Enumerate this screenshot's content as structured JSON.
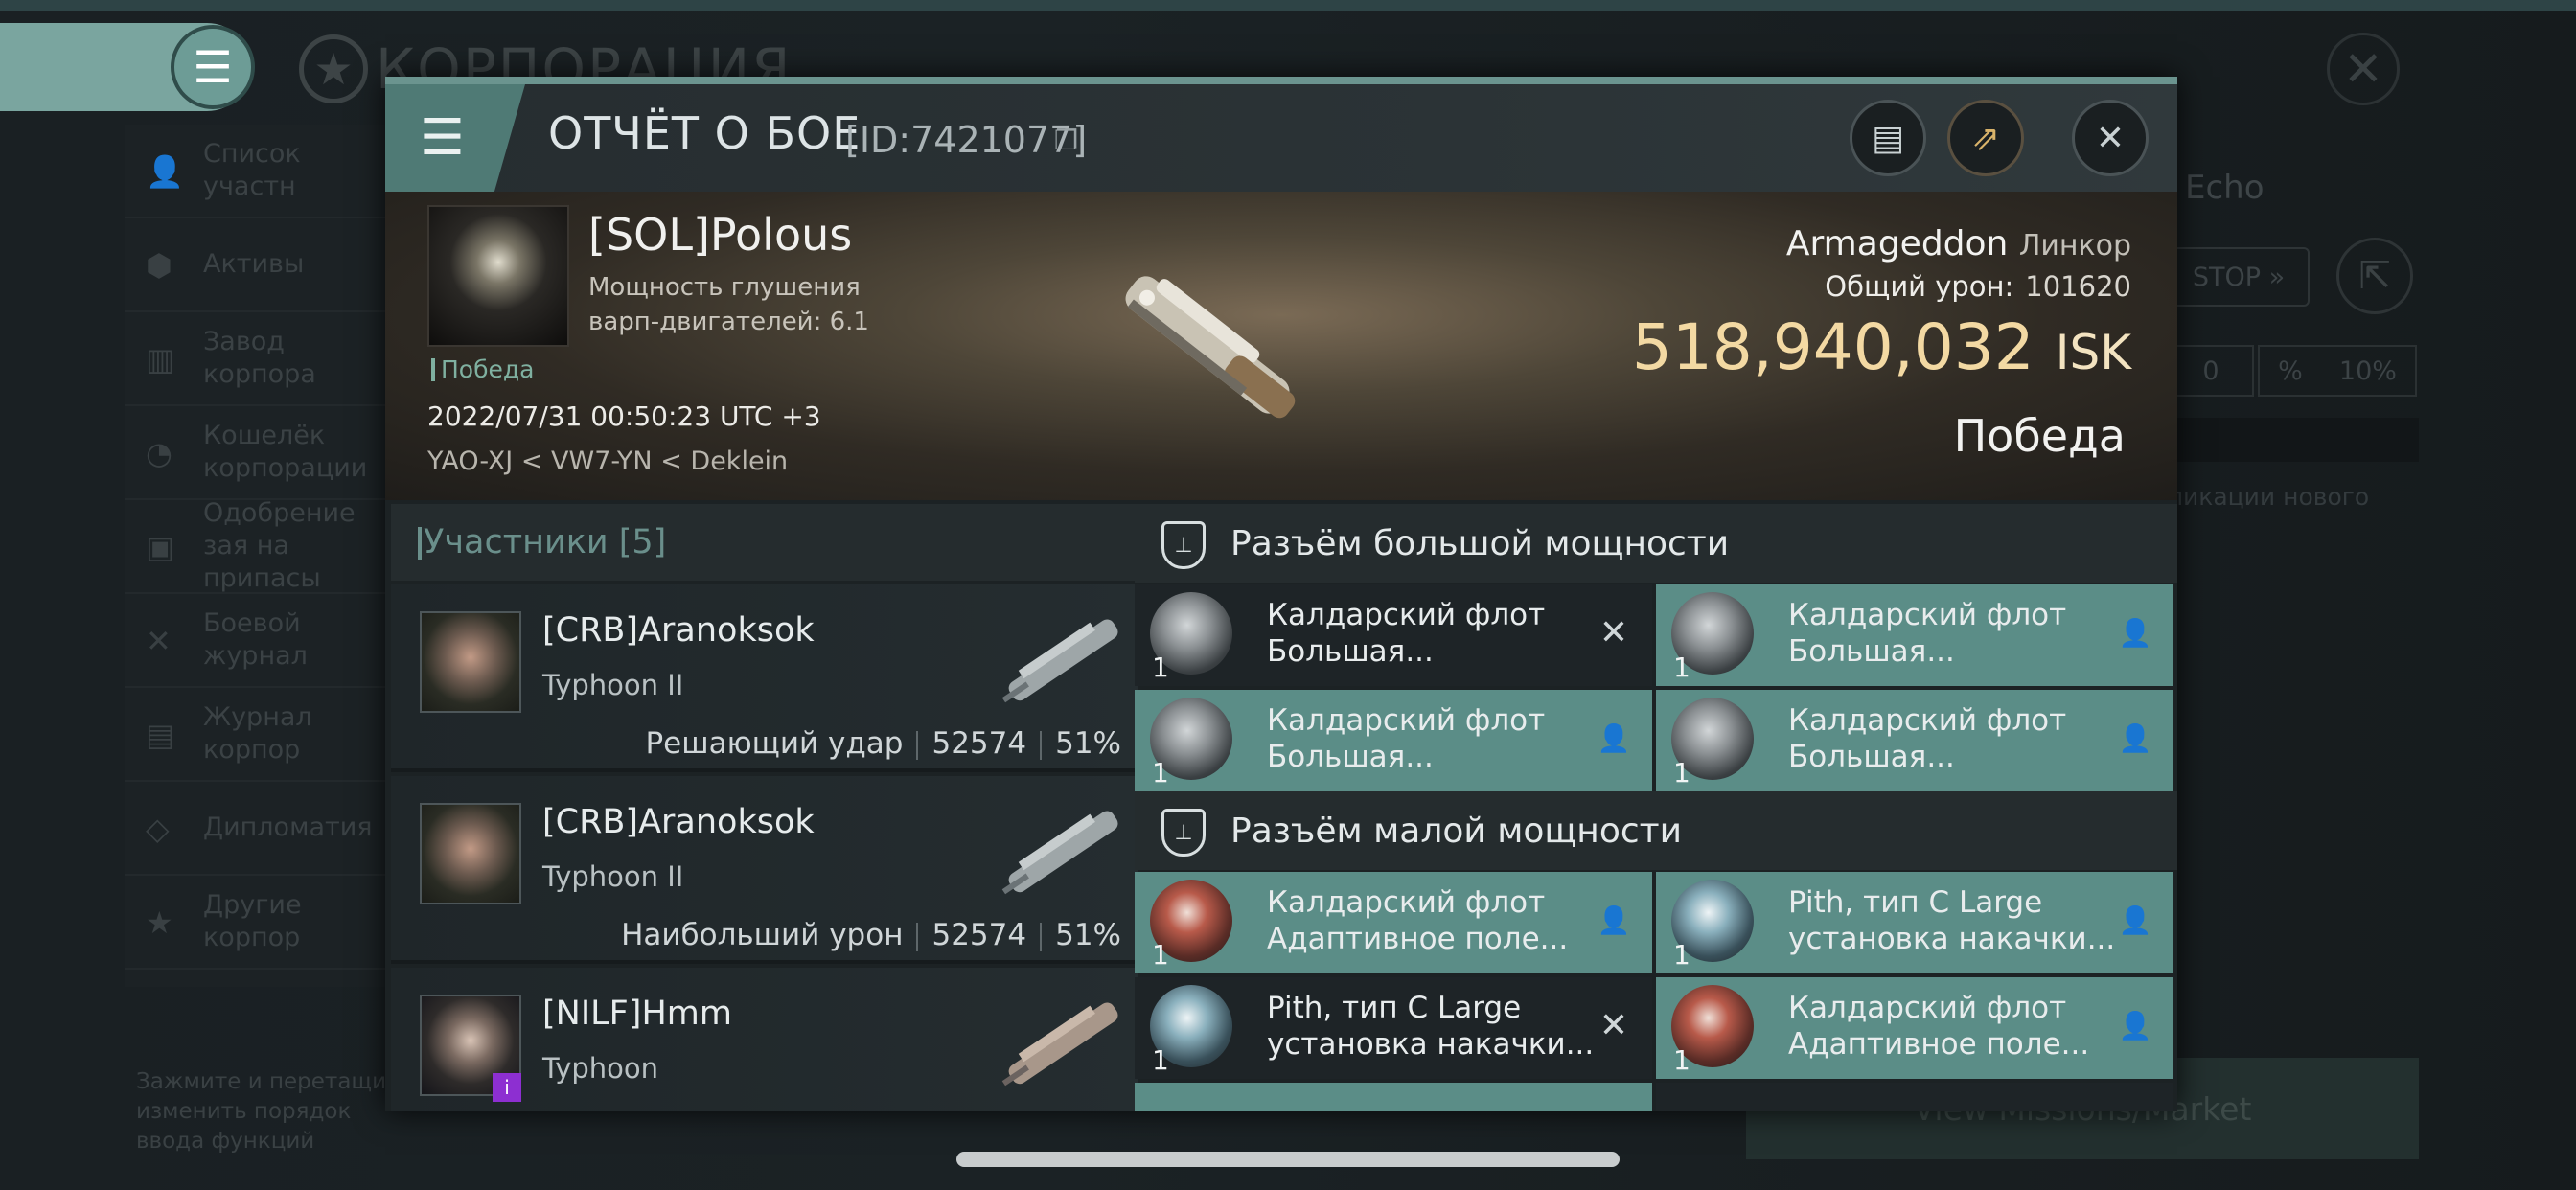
{
  "background": {
    "title": "КОРПОРАЦИЯ",
    "nav": [
      {
        "label": "Список участн",
        "icon": "members-icon"
      },
      {
        "label": "Активы",
        "icon": "assets-icon"
      },
      {
        "label": "Завод корпора",
        "icon": "factory-icon"
      },
      {
        "label": "Кошелёк корпорации",
        "icon": "wallet-icon"
      },
      {
        "label": "Одобрение зая на припасы",
        "icon": "approval-icon"
      },
      {
        "label": "Боевой журнал",
        "icon": "combat-log-icon"
      },
      {
        "label": "Журнал корпор",
        "icon": "journal-icon"
      },
      {
        "label": "Дипломатия",
        "icon": "diplomacy-icon"
      },
      {
        "label": "Другие корпор",
        "icon": "corporations-icon"
      }
    ],
    "hint": "Зажмите и перетащите изменить порядок ввода функций",
    "echo": "Echo",
    "stop": "STOP",
    "field1": "0",
    "field2": "10%",
    "subtext": "ликации нового",
    "bottom_button": "View Missions/Market"
  },
  "dialog": {
    "title": "ОТЧЁТ О БОЕ",
    "report_id": "[ID:7421077]",
    "victim": {
      "name": "[SOL]Polous",
      "stat_line": "Мощность глушения варп-двигателей: 6.1",
      "result_tag": "Победа",
      "datetime": "2022/07/31 00:50:23 UTC +3",
      "location": "YAO-XJ < VW7-YN < Deklein"
    },
    "ship": {
      "name": "Armageddon",
      "class": "Линкор"
    },
    "total_damage_label": "Общий урон:",
    "total_damage": "101620",
    "isk_value": "518,940,032",
    "isk_unit": "ISK",
    "outcome": "Победа",
    "participants_header": "Участники [5]",
    "participants": [
      {
        "name": "[CRB]Aranoksok",
        "ship": "Typhoon II",
        "role": "Решающий удар",
        "damage": "52574",
        "percent": "51%"
      },
      {
        "name": "[CRB]Aranoksok",
        "ship": "Typhoon II",
        "role": "Наибольший урон",
        "damage": "52574",
        "percent": "51%"
      },
      {
        "name": "[NILF]Hmm",
        "ship": "Typhoon",
        "role": "",
        "damage": "",
        "percent": "",
        "badge": "i"
      }
    ],
    "high_slots_title": "Разъём большой мощности",
    "high_slots": [
      {
        "line1": "Калдарский флот",
        "line2": "Большая...",
        "qty": "1",
        "state": "destroyed"
      },
      {
        "line1": "Калдарский флот",
        "line2": "Большая...",
        "qty": "1",
        "state": "dropped"
      },
      {
        "line1": "Калдарский флот",
        "line2": "Большая...",
        "qty": "1",
        "state": "dropped"
      },
      {
        "line1": "Калдарский флот",
        "line2": "Большая...",
        "qty": "1",
        "state": "dropped"
      }
    ],
    "low_slots_title": "Разъём малой мощности",
    "low_slots": [
      {
        "line1": "Калдарский флот",
        "line2": "Адаптивное поле...",
        "qty": "1",
        "state": "dropped",
        "icon": "red"
      },
      {
        "line1": "Pith, тип C Large",
        "line2": "установка накачки...",
        "qty": "1",
        "state": "dropped",
        "icon": "blu"
      },
      {
        "line1": "Pith, тип C Large",
        "line2": "установка накачки...",
        "qty": "1",
        "state": "destroyed",
        "icon": "blu"
      },
      {
        "line1": "Калдарский флот",
        "line2": "Адаптивное поле...",
        "qty": "1",
        "state": "dropped",
        "icon": "red"
      }
    ]
  }
}
